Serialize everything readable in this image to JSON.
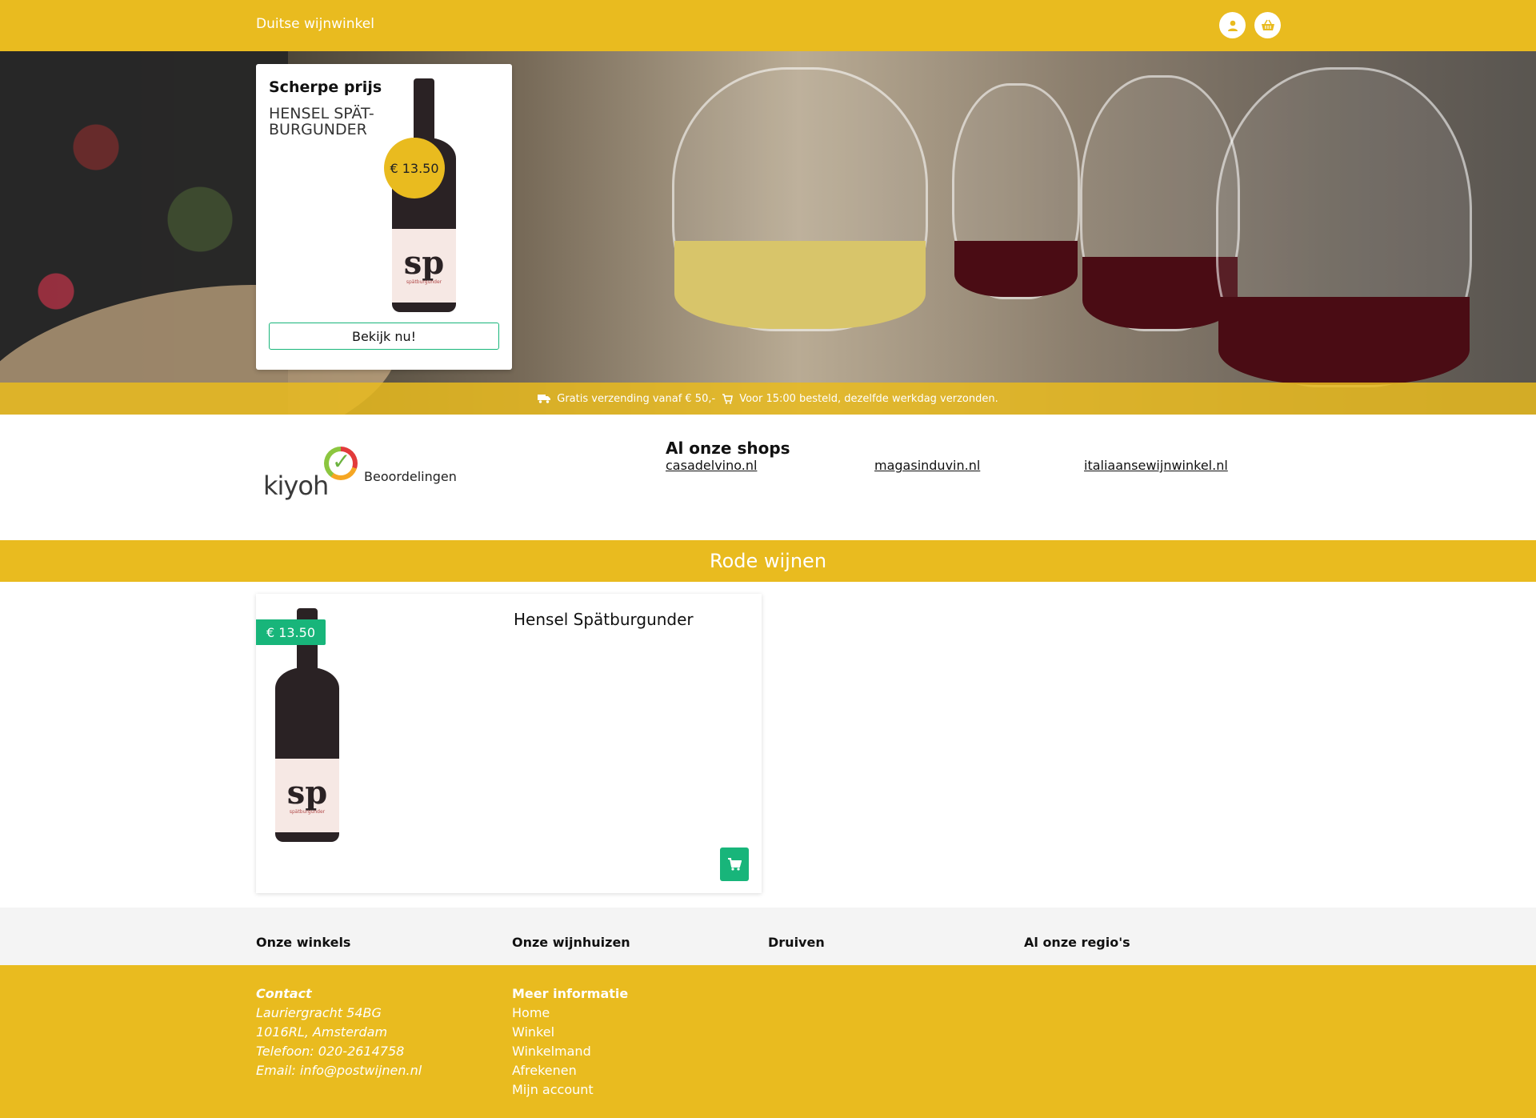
{
  "header": {
    "brand": "Duitse wijnwinkel",
    "icons": [
      "user-icon",
      "basket-icon"
    ]
  },
  "hero": {
    "promo": {
      "title": "Scherpe prijs",
      "product_name": "HENSEL SPÄT-BURGUNDER",
      "price": "€ 13.50",
      "button": "Bekijk nu!",
      "bottle_label": "sp",
      "bottle_sub": "spätburgunder"
    },
    "shipping": {
      "free_shipping": "Gratis verzending vanaf € 50,-",
      "same_day": "Voor 15:00 besteld, dezelfde werkdag verzonden."
    }
  },
  "reviews": {
    "logo_text": "kiyoh",
    "label": "Beoordelingen"
  },
  "shops": {
    "title": "Al onze shops",
    "links": [
      "casadelvino.nl",
      "magasinduvin.nl",
      "italiaansewijnwinkel.nl"
    ]
  },
  "section": {
    "title": "Rode wijnen"
  },
  "product": {
    "price": "€ 13.50",
    "name": "Hensel Spätburgunder",
    "bottle_label": "sp",
    "bottle_sub": "spätburgunder"
  },
  "footer": {
    "columns": [
      "Onze winkels",
      "Onze wijnhuizen",
      "Druiven",
      "Al onze regio's"
    ],
    "contact": {
      "heading": "Contact",
      "street": "Lauriergracht 54BG",
      "city": "1016RL, Amsterdam",
      "phone": "Telefoon: 020-2614758",
      "email": "Email: info@postwijnen.nl"
    },
    "info": {
      "heading": "Meer informatie",
      "links": [
        "Home",
        "Winkel",
        "Winkelmand",
        "Afrekenen",
        "Mijn account"
      ]
    }
  },
  "colors": {
    "brand_yellow": "#E9BB1F",
    "accent_green": "#18B57A"
  }
}
